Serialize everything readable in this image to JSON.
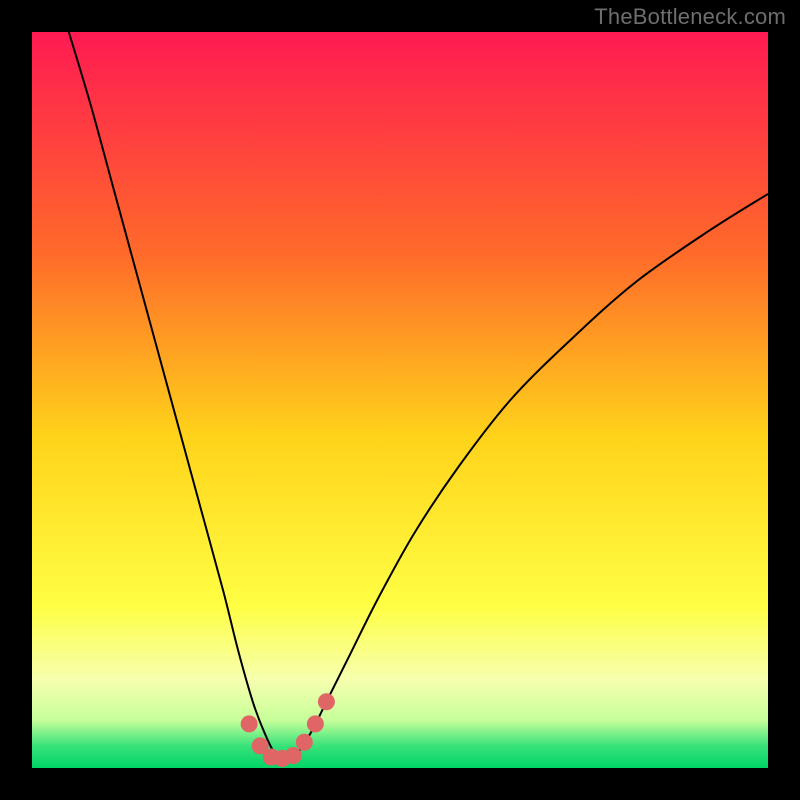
{
  "watermark": "TheBottleneck.com",
  "colors": {
    "frame": "#000000",
    "gradient_stops": [
      {
        "offset": 0,
        "color": "#ff1a52"
      },
      {
        "offset": 0.3,
        "color": "#ff6a2a"
      },
      {
        "offset": 0.55,
        "color": "#ffd31a"
      },
      {
        "offset": 0.78,
        "color": "#ffff44"
      },
      {
        "offset": 0.88,
        "color": "#f6ffae"
      },
      {
        "offset": 0.935,
        "color": "#c7ff9a"
      },
      {
        "offset": 0.97,
        "color": "#38e27a"
      },
      {
        "offset": 1.0,
        "color": "#00d466"
      }
    ],
    "curve_stroke": "#000000",
    "marker_fill": "#e06666",
    "marker_stroke": "#e06666"
  },
  "chart_data": {
    "type": "line",
    "title": "",
    "xlabel": "",
    "ylabel": "",
    "xlim": [
      0,
      100
    ],
    "ylim": [
      0,
      100
    ],
    "grid": false,
    "legend": false,
    "series": [
      {
        "name": "bottleneck-curve",
        "x": [
          5,
          8,
          11,
          14,
          17,
          20,
          23,
          26,
          28,
          30,
          31.5,
          33,
          34.5,
          36,
          38,
          40,
          43,
          47,
          52,
          58,
          65,
          73,
          82,
          92,
          100
        ],
        "y": [
          100,
          90,
          79,
          68,
          57,
          46,
          35,
          24,
          16,
          9,
          5,
          2,
          1.5,
          2,
          5,
          9,
          15,
          23,
          32,
          41,
          50,
          58,
          66,
          73,
          78
        ]
      }
    ],
    "markers": {
      "name": "highlighted-points",
      "x": [
        29.5,
        31,
        32.5,
        34,
        35.5,
        37,
        38.5,
        40
      ],
      "y": [
        6,
        3,
        1.5,
        1.3,
        1.7,
        3.5,
        6,
        9
      ]
    },
    "annotations": []
  }
}
